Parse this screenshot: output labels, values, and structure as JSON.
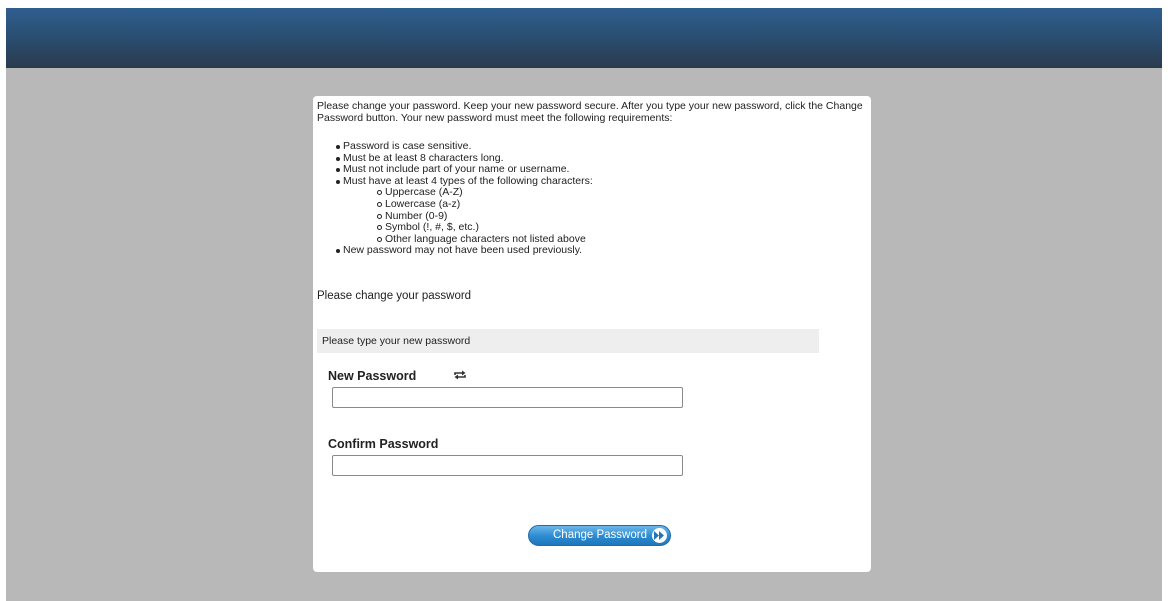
{
  "intro_text": "Please change your password. Keep your new password secure. After you type your new password, click the Change Password button. Your new password must meet the following requirements:",
  "requirements": {
    "case_sensitive": "Password is case sensitive.",
    "min_length": "Must be at least 8 characters long.",
    "no_name": "Must not include part of your name or username.",
    "types_intro": "Must have at least 4 types of the following characters:",
    "types": [
      "Uppercase (A-Z)",
      "Lowercase (a-z)",
      "Number (0-9)",
      "Symbol (!, #, $, etc.)",
      "Other language characters not listed above"
    ],
    "not_reused": "New password may not have been used previously."
  },
  "change_heading": "Please change your password",
  "section_bar_label": "Please type your new password",
  "new_password": {
    "label": "New Password",
    "value": "",
    "toggle_icon": "refresh-icon"
  },
  "confirm_password": {
    "label": "Confirm Password",
    "value": ""
  },
  "submit": {
    "label": "Change Password",
    "icon": "double-chevron-right-icon"
  },
  "colors": {
    "header_top": "#2f5f8f",
    "header_bottom": "#2b3b4d",
    "page_background": "#b8b8b8",
    "button_blue": "#2b8ad0"
  }
}
